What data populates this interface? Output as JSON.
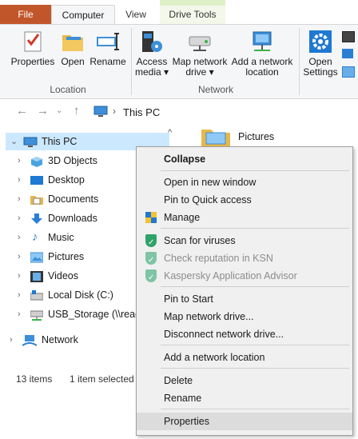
{
  "ribbon": {
    "tabs": {
      "file": "File",
      "computer": "Computer",
      "view": "View",
      "drive_tools": "Drive Tools"
    },
    "location_group": {
      "label": "Location",
      "buttons": {
        "properties": "Properties",
        "open": "Open",
        "rename": "Rename"
      }
    },
    "network_group": {
      "label": "Network",
      "buttons": {
        "access_media_line1": "Access",
        "access_media_line2": "media ▾",
        "map_drive_line1": "Map network",
        "map_drive_line2": "drive ▾",
        "add_location_line1": "Add a network",
        "add_location_line2": "location"
      }
    },
    "system_group": {
      "open_settings_line1": "Open",
      "open_settings_line2": "Settings"
    }
  },
  "address_bar": {
    "path": "This PC",
    "separator": "›"
  },
  "nav_pane": {
    "root": "This PC",
    "items": [
      {
        "label": "3D Objects",
        "icon": "cube-icon"
      },
      {
        "label": "Desktop",
        "icon": "desktop-icon"
      },
      {
        "label": "Documents",
        "icon": "documents-icon"
      },
      {
        "label": "Downloads",
        "icon": "download-icon"
      },
      {
        "label": "Music",
        "icon": "music-icon"
      },
      {
        "label": "Pictures",
        "icon": "pictures-icon"
      },
      {
        "label": "Videos",
        "icon": "videos-icon"
      },
      {
        "label": "Local Disk (C:)",
        "icon": "disk-icon"
      },
      {
        "label": "USB_Storage (\\\\ready",
        "icon": "network-drive-icon"
      }
    ],
    "network": "Network"
  },
  "content": {
    "pictures_label": "Pictures"
  },
  "status_bar": {
    "items": "13 items",
    "selected": "1 item selected"
  },
  "context_menu": {
    "collapse": "Collapse",
    "open_new_window": "Open in new window",
    "pin_quick_access": "Pin to Quick access",
    "manage": "Manage",
    "scan_viruses": "Scan for viruses",
    "check_reputation": "Check reputation in KSN",
    "kaspersky_advisor": "Kaspersky Application Advisor",
    "pin_start": "Pin to Start",
    "map_network_drive": "Map network drive...",
    "disconnect_network_drive": "Disconnect network drive...",
    "add_network_location": "Add a network location",
    "delete": "Delete",
    "rename": "Rename",
    "properties": "Properties"
  },
  "colors": {
    "file_tab": "#c2562b",
    "selection": "#cce8ff",
    "menu_bg": "#f0f0f0",
    "kaspersky_green": "#2fa36b"
  }
}
